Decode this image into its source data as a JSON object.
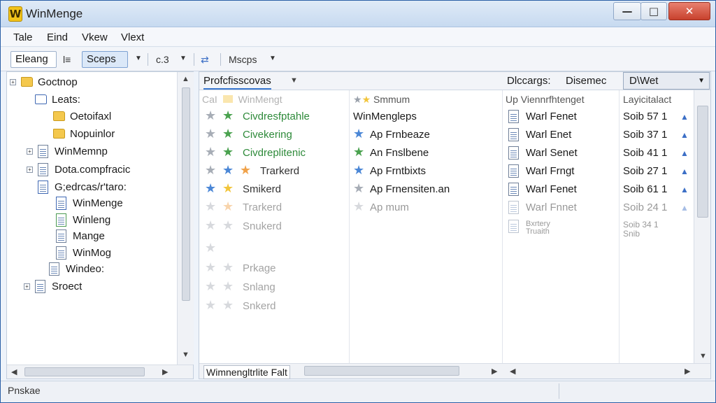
{
  "window": {
    "title": "WinMenge",
    "logo": "W"
  },
  "menu": [
    "Tale",
    "Eind",
    "Vkew",
    "Vlext"
  ],
  "toolbar": {
    "box1": "Eleang",
    "label1": "l≡",
    "box2": "Sceps",
    "label2": "c.3",
    "label3": "Mscps"
  },
  "tree": [
    {
      "label": "Goctnop",
      "icon": "folder",
      "expand": "+"
    },
    {
      "label": "Leats:",
      "icon": "folder-outline",
      "expand": ""
    },
    {
      "label": "Oetoifaxl",
      "icon": "folder",
      "expand": ""
    },
    {
      "label": "Nopuinlor",
      "icon": "folder",
      "expand": ""
    },
    {
      "label": "WinMemnp",
      "icon": "doc",
      "expand": "+"
    },
    {
      "label": "Dota.compfracic",
      "icon": "doc",
      "expand": "+"
    },
    {
      "label": "G;edrcas/r'taro:",
      "icon": "doc",
      "expand": ""
    },
    {
      "label": "WinMenge",
      "icon": "doc",
      "expand": ""
    },
    {
      "label": "Winleng",
      "icon": "doc",
      "expand": ""
    },
    {
      "label": "Mange",
      "icon": "doc",
      "expand": ""
    },
    {
      "label": "WinMog",
      "icon": "doc",
      "expand": ""
    },
    {
      "label": "Windeo:",
      "icon": "doc",
      "expand": ""
    },
    {
      "label": "Sroect",
      "icon": "doc",
      "expand": "+"
    }
  ],
  "right": {
    "tab_active": "Profcfisscovas",
    "tab2": "Dlccargs:",
    "tab3": "Disemec",
    "combo": "D\\Wet",
    "col1": "WinMengt",
    "col1_prefix": "CaI",
    "col2": "Smmum",
    "col3": "Up Viennrfhtenget",
    "col4": "Layicitalact",
    "rows": [
      {
        "name": "Civdresfptahle",
        "desc": "WinMengleps",
        "file": "Warl Fenet",
        "size": "Soib 57 1"
      },
      {
        "name": "Civekering",
        "desc": "Ap Frnbeaze",
        "file": "Warl Enet",
        "size": "Soib 37 1"
      },
      {
        "name": "Civdreplitenic",
        "desc": "An Fnslbene",
        "file": "Warl Senet",
        "size": "Soib 41 1"
      },
      {
        "name": "Trarkerd",
        "desc": "Ap Frntbixts",
        "file": "Warl Frngt",
        "size": "Soib 27 1"
      },
      {
        "name": "Smikerd",
        "desc": "Ap Frnensiten.an",
        "file": "Warl Fenet",
        "size": "Soib 61 1"
      },
      {
        "name": "Trarkerd",
        "desc": "Ap mum",
        "file": "Warl Fnnet",
        "size": "Soib 24 1"
      },
      {
        "name": "Snukerd",
        "desc": "",
        "file": "Bxrtery Truaith",
        "size": "Soib 34 1 Snib"
      },
      {
        "name": "",
        "desc": "",
        "file": "",
        "size": ""
      },
      {
        "name": "Prkage",
        "desc": "",
        "file": "",
        "size": ""
      },
      {
        "name": "Snlang",
        "desc": "",
        "file": "",
        "size": ""
      },
      {
        "name": "Snkerd",
        "desc": "",
        "file": "",
        "size": ""
      }
    ],
    "hscroll_label": "Wimnengltrlite Falt"
  },
  "status": {
    "text": "Pnskae"
  }
}
